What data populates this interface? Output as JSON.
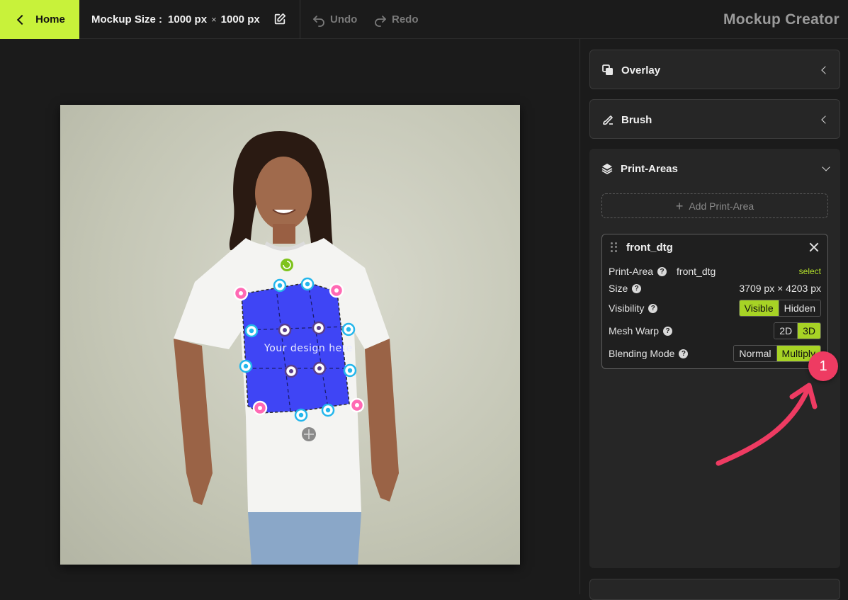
{
  "topbar": {
    "home_label": "Home",
    "mockup_size_label": "Mockup Size :",
    "width_value": "1000 px",
    "times": "×",
    "height_value": "1000 px",
    "undo_label": "Undo",
    "redo_label": "Redo",
    "app_title": "Mockup Creator"
  },
  "canvas": {
    "design_placeholder": "Your design here"
  },
  "panels": {
    "overlay_label": "Overlay",
    "brush_label": "Brush",
    "print_areas_label": "Print-Areas",
    "add_print_area_label": "Add Print-Area"
  },
  "print_area_card": {
    "title": "front_dtg",
    "print_area_label": "Print-Area",
    "print_area_value": "front_dtg",
    "select_label": "select",
    "size_label": "Size",
    "size_value": "3709 px × 4203 px",
    "visibility_label": "Visibility",
    "visibility_options": [
      "Visible",
      "Hidden"
    ],
    "visibility_selected": "Visible",
    "mesh_warp_label": "Mesh Warp",
    "mesh_warp_options": [
      "2D",
      "3D"
    ],
    "mesh_warp_selected": "3D",
    "blending_label": "Blending Mode",
    "blending_options": [
      "Normal",
      "Multiply"
    ],
    "blending_selected": "Multiply"
  },
  "annotation": {
    "badge_number": "1"
  },
  "colors": {
    "accent": "#c8f23a",
    "active_segment": "#a7d325",
    "badge": "#ee3b62",
    "design_area": "#3f45f5"
  }
}
